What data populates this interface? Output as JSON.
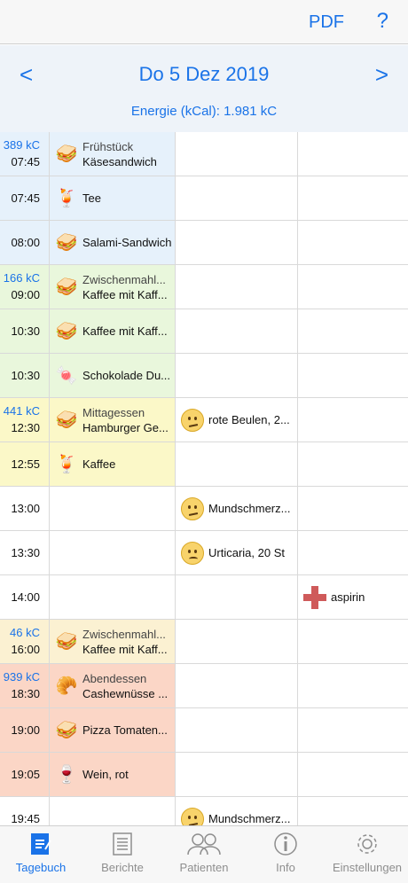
{
  "header": {
    "pdf_label": "PDF",
    "help_label": "?"
  },
  "date_nav": {
    "prev": "<",
    "next": ">",
    "date": "Do 5 Dez 2019",
    "energy": "Energie (kCal): 1.981 kC"
  },
  "rows": [
    {
      "kc": "389 kC",
      "time": "07:45",
      "bg": "bg-blue",
      "meal": {
        "icon": "sandwich-icon",
        "cat": "Frühstück",
        "text": "Käsesandwich"
      }
    },
    {
      "time": "07:45",
      "bg": "bg-blue",
      "meal": {
        "icon": "drink-icon",
        "text": "Tee"
      }
    },
    {
      "time": "08:00",
      "bg": "bg-blue",
      "meal": {
        "icon": "sandwich-icon",
        "text": "Salami-Sandwich"
      }
    },
    {
      "kc": "166 kC",
      "time": "09:00",
      "bg": "bg-green",
      "meal": {
        "icon": "sandwich-icon",
        "cat": "Zwischenmahl...",
        "text": "Kaffee mit Kaff..."
      }
    },
    {
      "time": "10:30",
      "bg": "bg-green",
      "meal": {
        "icon": "sandwich-icon",
        "text": "Kaffee mit Kaff..."
      }
    },
    {
      "time": "10:30",
      "bg": "bg-green",
      "meal": {
        "icon": "sweets-icon",
        "text": "Schokolade Du..."
      }
    },
    {
      "kc": "441 kC",
      "time": "12:30",
      "bg": "bg-yellow",
      "meal": {
        "icon": "sandwich-icon",
        "cat": "Mittagessen",
        "text": "Hamburger Ge..."
      },
      "symptom": {
        "icon": "neutral-face-icon",
        "text": "rote Beulen, 2..."
      }
    },
    {
      "time": "12:55",
      "bg": "bg-yellow",
      "meal": {
        "icon": "drink-icon",
        "text": "Kaffee"
      }
    },
    {
      "time": "13:00",
      "symptom": {
        "icon": "neutral-face-icon",
        "text": "Mundschmerz..."
      }
    },
    {
      "time": "13:30",
      "symptom": {
        "icon": "sad-face-icon",
        "text": "Urticaria, 20 St"
      }
    },
    {
      "time": "14:00",
      "med": {
        "icon": "medication-cross-icon",
        "text": "aspirin"
      }
    },
    {
      "kc": "46 kC",
      "time": "16:00",
      "bg": "bg-beige",
      "meal": {
        "icon": "sandwich-icon",
        "cat": "Zwischenmahl...",
        "text": "Kaffee mit Kaff..."
      }
    },
    {
      "kc": "939 kC",
      "time": "18:30",
      "bg": "bg-salmon",
      "meal": {
        "icon": "croissant-icon",
        "cat": "Abendessen",
        "text": "Cashewnüsse ..."
      }
    },
    {
      "time": "19:00",
      "bg": "bg-salmon",
      "meal": {
        "icon": "sandwich-icon",
        "text": "Pizza Tomaten..."
      }
    },
    {
      "time": "19:05",
      "bg": "bg-salmon",
      "meal": {
        "icon": "wine-icon",
        "text": "Wein, rot"
      }
    },
    {
      "time": "19:45",
      "symptom": {
        "icon": "neutral-face-icon",
        "text": "Mundschmerz..."
      }
    }
  ],
  "tabs": [
    {
      "label": "Tagebuch",
      "icon": "diary-icon",
      "active": true
    },
    {
      "label": "Berichte",
      "icon": "reports-icon"
    },
    {
      "label": "Patienten",
      "icon": "patients-icon"
    },
    {
      "label": "Info",
      "icon": "info-icon"
    },
    {
      "label": "Einstellungen",
      "icon": "settings-icon"
    }
  ]
}
